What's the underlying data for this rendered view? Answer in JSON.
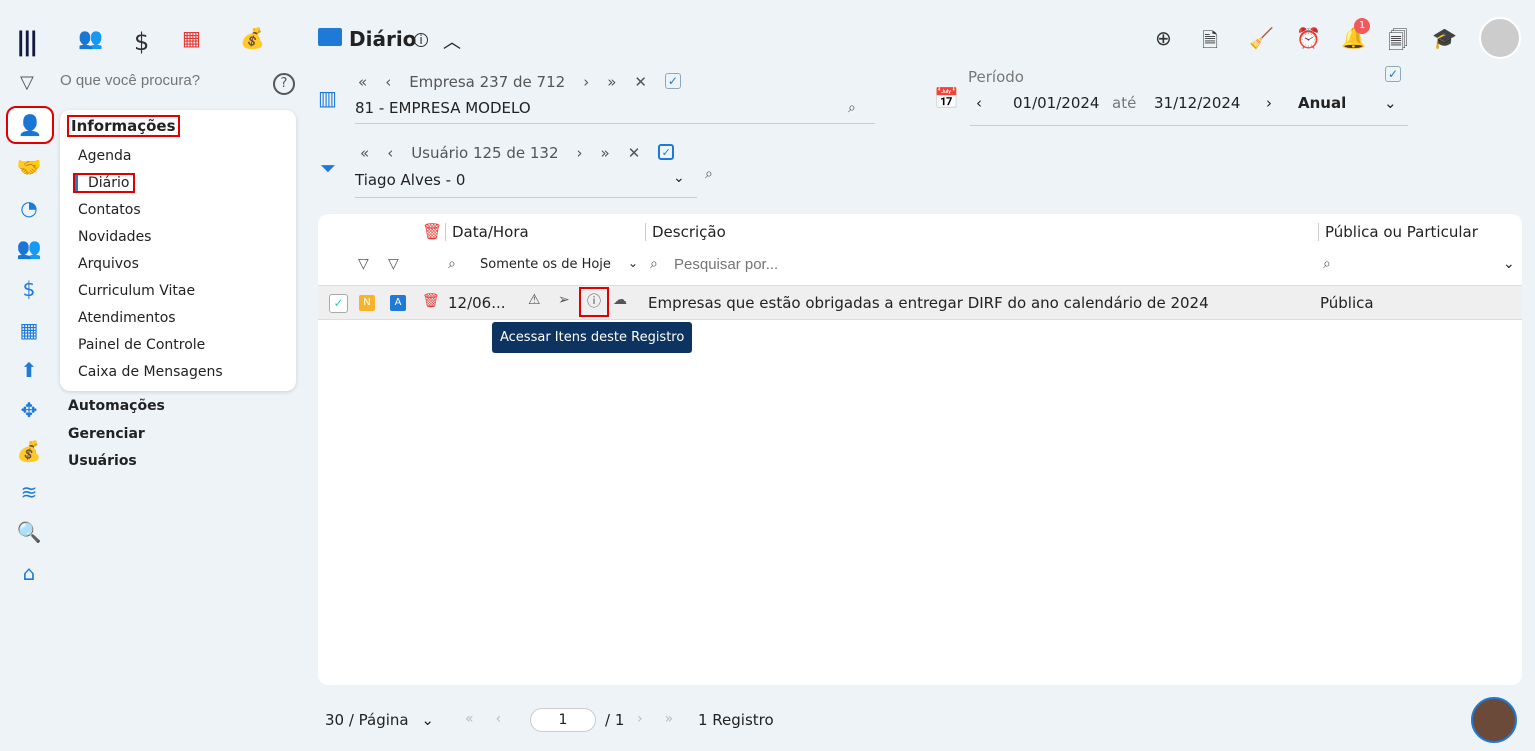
{
  "top_nav": {
    "icons": [
      "people-icon",
      "dollar-icon",
      "calculator-icon",
      "money-bag-icon"
    ]
  },
  "search": {
    "placeholder": "O que você procura?"
  },
  "menu": {
    "title": "Informações",
    "items": [
      "Agenda",
      "Diário",
      "Contatos",
      "Novidades",
      "Arquivos",
      "Curriculum Vitae",
      "Atendimentos",
      "Painel de Controle",
      "Caixa de Mensagens"
    ],
    "sections": [
      "Automações",
      "Gerenciar",
      "Usuários"
    ]
  },
  "header": {
    "title": "Diário"
  },
  "empresa": {
    "nav": "Empresa 237 de 712",
    "value": "81 - EMPRESA MODELO"
  },
  "usuario": {
    "nav": "Usuário 125 de 132",
    "value": "Tiago Alves - 0"
  },
  "periodo": {
    "label": "Período",
    "start": "01/01/2024",
    "sep": "até",
    "end": "31/12/2024",
    "type": "Anual"
  },
  "notifications": {
    "count": "1"
  },
  "table": {
    "headers": [
      "Data/Hora",
      "Descrição",
      "Pública ou Particular"
    ],
    "date_filter": "Somente os de Hoje",
    "search_placeholder": "Pesquisar por...",
    "rows": [
      {
        "badge_n": "N",
        "badge_a": "A",
        "date": "12/06...",
        "description": "Empresas que estão obrigadas a entregar DIRF do ano calendário de 2024",
        "visibility": "Pública"
      }
    ]
  },
  "tooltip": "Acessar Itens deste Registro",
  "footer": {
    "per_page": "30 / Página",
    "page": "1",
    "total_pages": "/ 1",
    "records": "1 Registro"
  },
  "colors": {
    "accent": "#1e7ad6",
    "tooltip": "#0d3360",
    "danger": "#e53935"
  }
}
